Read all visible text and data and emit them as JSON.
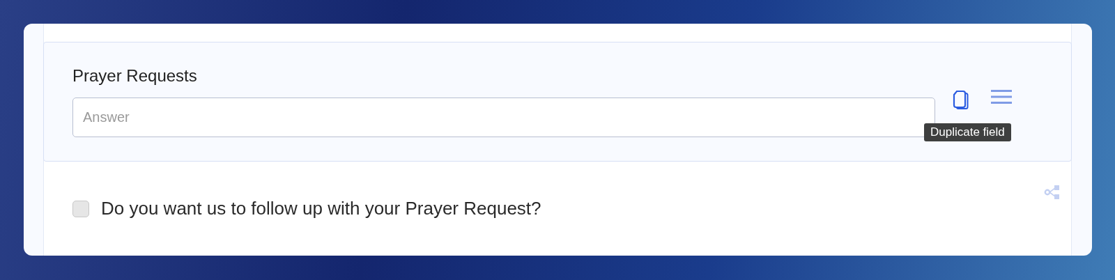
{
  "field": {
    "label": "Prayer Requests",
    "placeholder": "Answer",
    "tooltip": "Duplicate field"
  },
  "checkbox": {
    "label": "Do you want us to follow up with your Prayer Request?",
    "checked": false
  }
}
